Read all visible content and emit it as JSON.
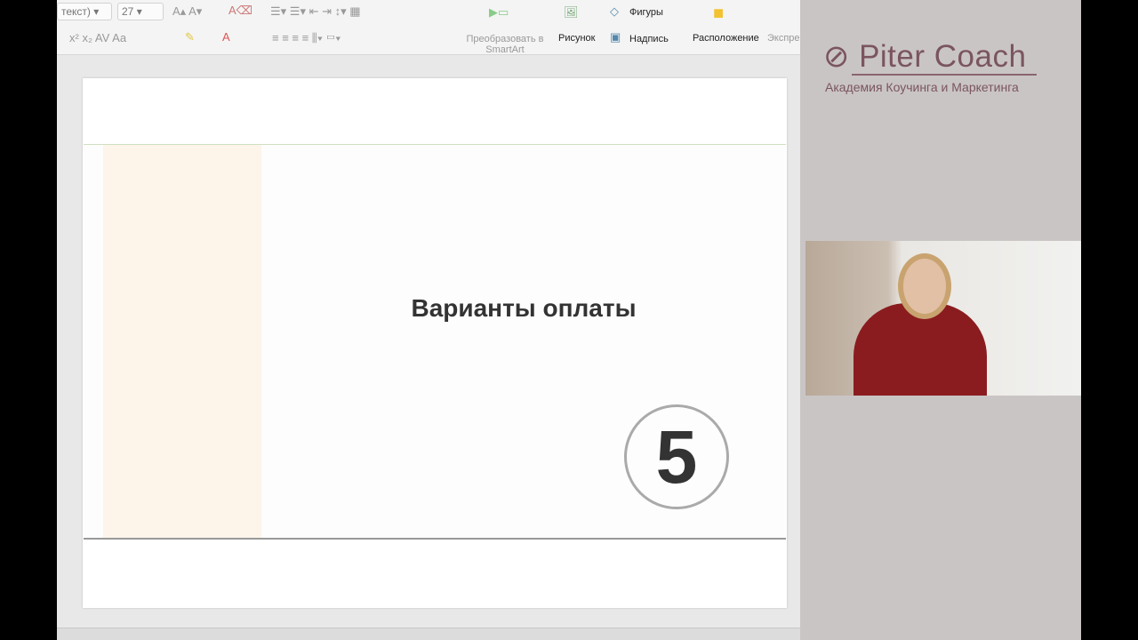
{
  "ribbon": {
    "font_name": "текст)",
    "font_size": "27",
    "convert_smartart": "Преобразовать в SmartArt",
    "picture": "Рисунок",
    "shapes": "Фигуры",
    "textbox": "Надпись",
    "arrange": "Расположение",
    "quick_styles": "Экспре"
  },
  "slide": {
    "title": "Варианты оплаты",
    "number": "5"
  },
  "branding": {
    "logo": "Piter Coach",
    "tagline": "Академия Коучинга и Маркетинга"
  }
}
